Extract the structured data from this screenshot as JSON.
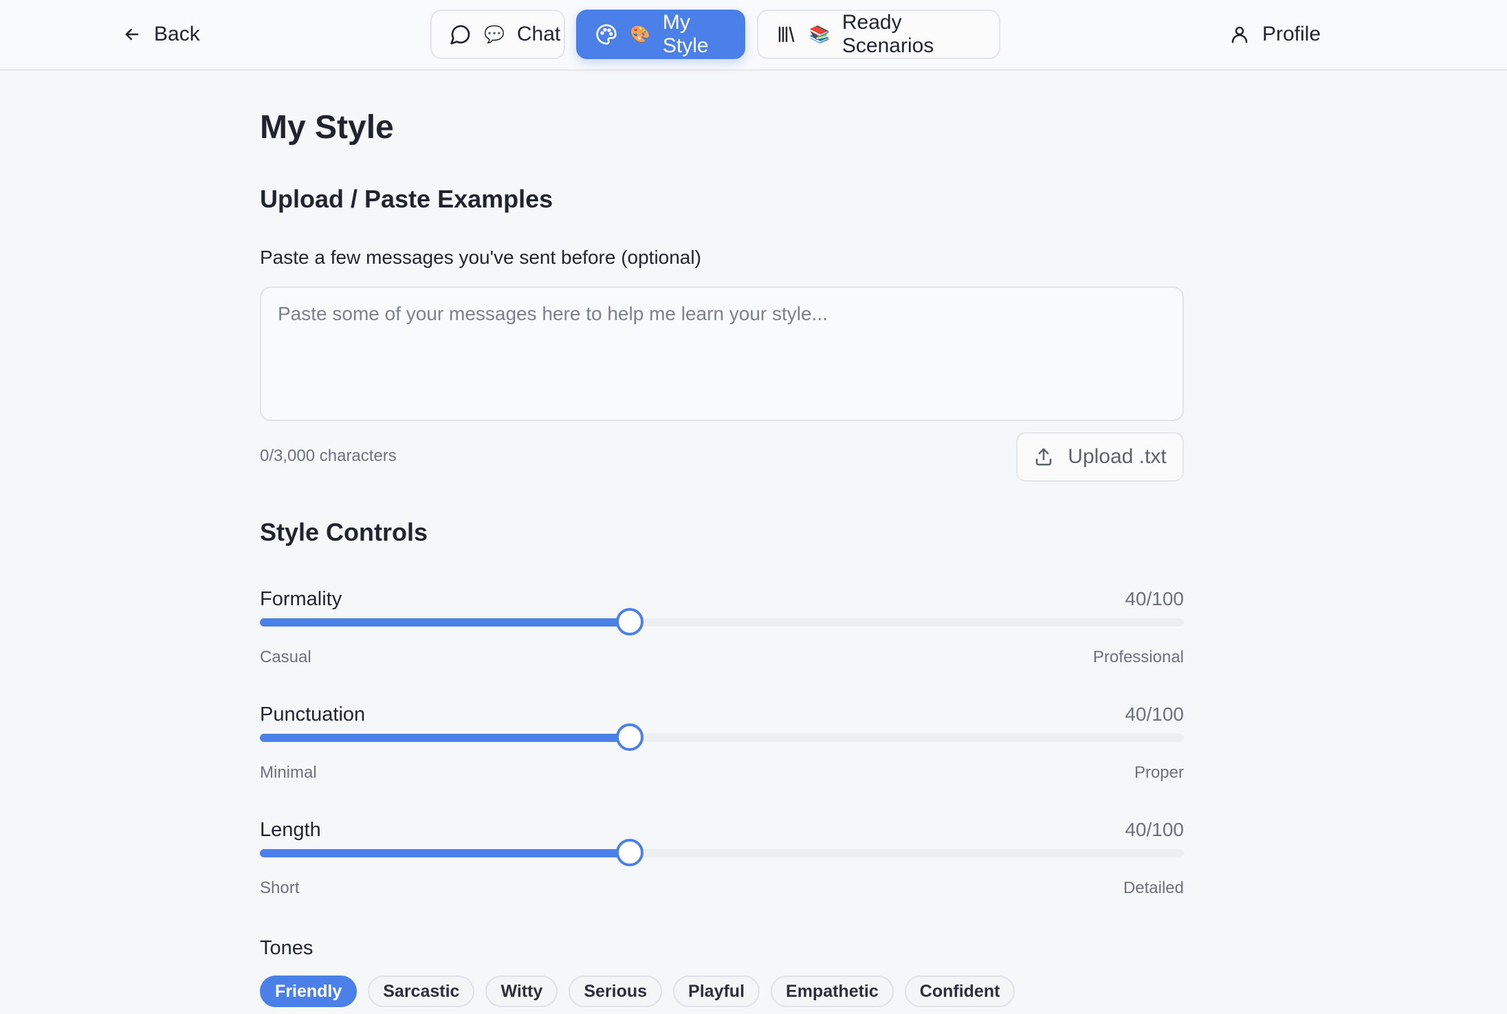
{
  "topbar": {
    "back_label": "Back",
    "tabs": [
      {
        "label": "Chat",
        "emoji": "💬",
        "icon": "chat-bubble-icon",
        "active": false
      },
      {
        "label": "My Style",
        "emoji": "🎨",
        "icon": "palette-icon",
        "active": true
      },
      {
        "label": "Ready Scenarios",
        "emoji": "📚",
        "icon": "library-icon",
        "active": false
      }
    ],
    "profile_label": "Profile"
  },
  "page": {
    "title": "My Style",
    "examples_heading": "Upload / Paste Examples",
    "examples_label": "Paste a few messages you've sent before (optional)",
    "examples_placeholder": "Paste some of your messages here to help me learn your style...",
    "examples_value": "",
    "char_count": "0/3,000 characters",
    "upload_label": "Upload .txt",
    "controls_heading": "Style Controls",
    "sliders": [
      {
        "name": "Formality",
        "value": 40,
        "max": 100,
        "value_text": "40/100",
        "low": "Casual",
        "high": "Professional"
      },
      {
        "name": "Punctuation",
        "value": 40,
        "max": 100,
        "value_text": "40/100",
        "low": "Minimal",
        "high": "Proper"
      },
      {
        "name": "Length",
        "value": 40,
        "max": 100,
        "value_text": "40/100",
        "low": "Short",
        "high": "Detailed"
      }
    ],
    "tones_label": "Tones",
    "tones": [
      {
        "label": "Friendly",
        "selected": true
      },
      {
        "label": "Sarcastic",
        "selected": false
      },
      {
        "label": "Witty",
        "selected": false
      },
      {
        "label": "Serious",
        "selected": false
      },
      {
        "label": "Playful",
        "selected": false
      },
      {
        "label": "Empathetic",
        "selected": false
      },
      {
        "label": "Confident",
        "selected": false
      }
    ]
  },
  "colors": {
    "accent": "#4a80e8",
    "background": "#f6f7f9",
    "text": "#1f2430",
    "muted": "#6b7180"
  }
}
